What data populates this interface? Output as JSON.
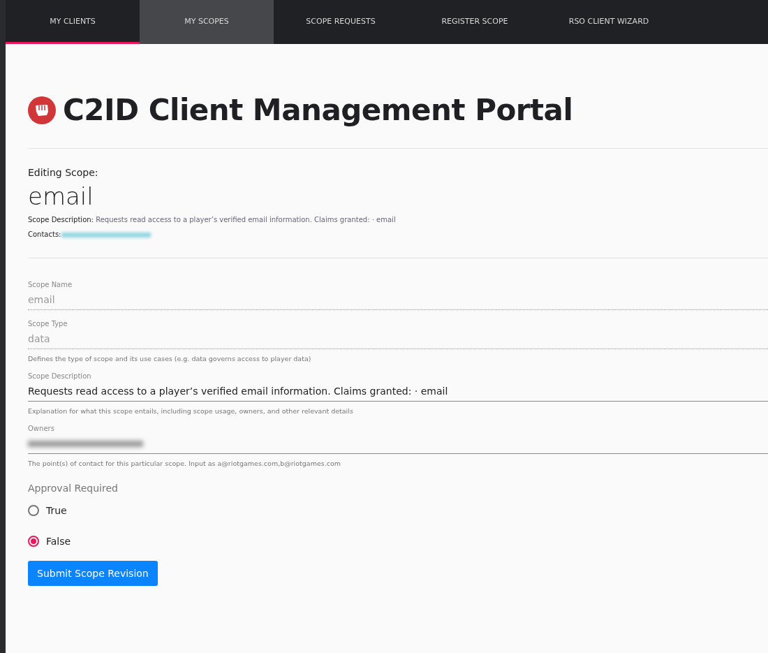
{
  "nav": {
    "tabs": [
      {
        "label": "MY CLIENTS",
        "selected": true,
        "hovered": false
      },
      {
        "label": "MY SCOPES",
        "selected": false,
        "hovered": true
      },
      {
        "label": "SCOPE REQUESTS",
        "selected": false,
        "hovered": false
      },
      {
        "label": "REGISTER SCOPE",
        "selected": false,
        "hovered": false
      },
      {
        "label": "RSO CLIENT WIZARD",
        "selected": false,
        "hovered": false
      }
    ]
  },
  "page": {
    "title": "C2ID Client Management Portal"
  },
  "summary": {
    "heading": "Editing Scope:",
    "scope_name": "email",
    "description_label": "Scope Description:",
    "description": "Requests read access to a player’s verified email information. Claims granted:  ·  email",
    "contacts_label": "Contacts:",
    "contacts_blurred": true
  },
  "form": {
    "fields": [
      {
        "label": "Scope Name",
        "value": "email",
        "disabled": true
      },
      {
        "label": "Scope Type",
        "value": "data",
        "disabled": true,
        "help": "Defines the type of scope and its use cases (e.g. data governs access to player data)"
      },
      {
        "label": "Scope Description",
        "value": "Requests read access to a player’s verified email information. Claims granted:  ·  email",
        "disabled": false,
        "help": "Explanation for what this scope entails, including scope usage, owners, and other relevant details"
      },
      {
        "label": "Owners",
        "value_blurred": true,
        "disabled": false,
        "help": "The point(s) of contact for this particular scope. Input as a@riotgames.com,b@riotgames.com"
      }
    ],
    "approval": {
      "label": "Approval Required",
      "options": [
        {
          "label": "True",
          "selected": false
        },
        {
          "label": "False",
          "selected": true
        }
      ]
    },
    "submit": "Submit Scope Revision"
  }
}
